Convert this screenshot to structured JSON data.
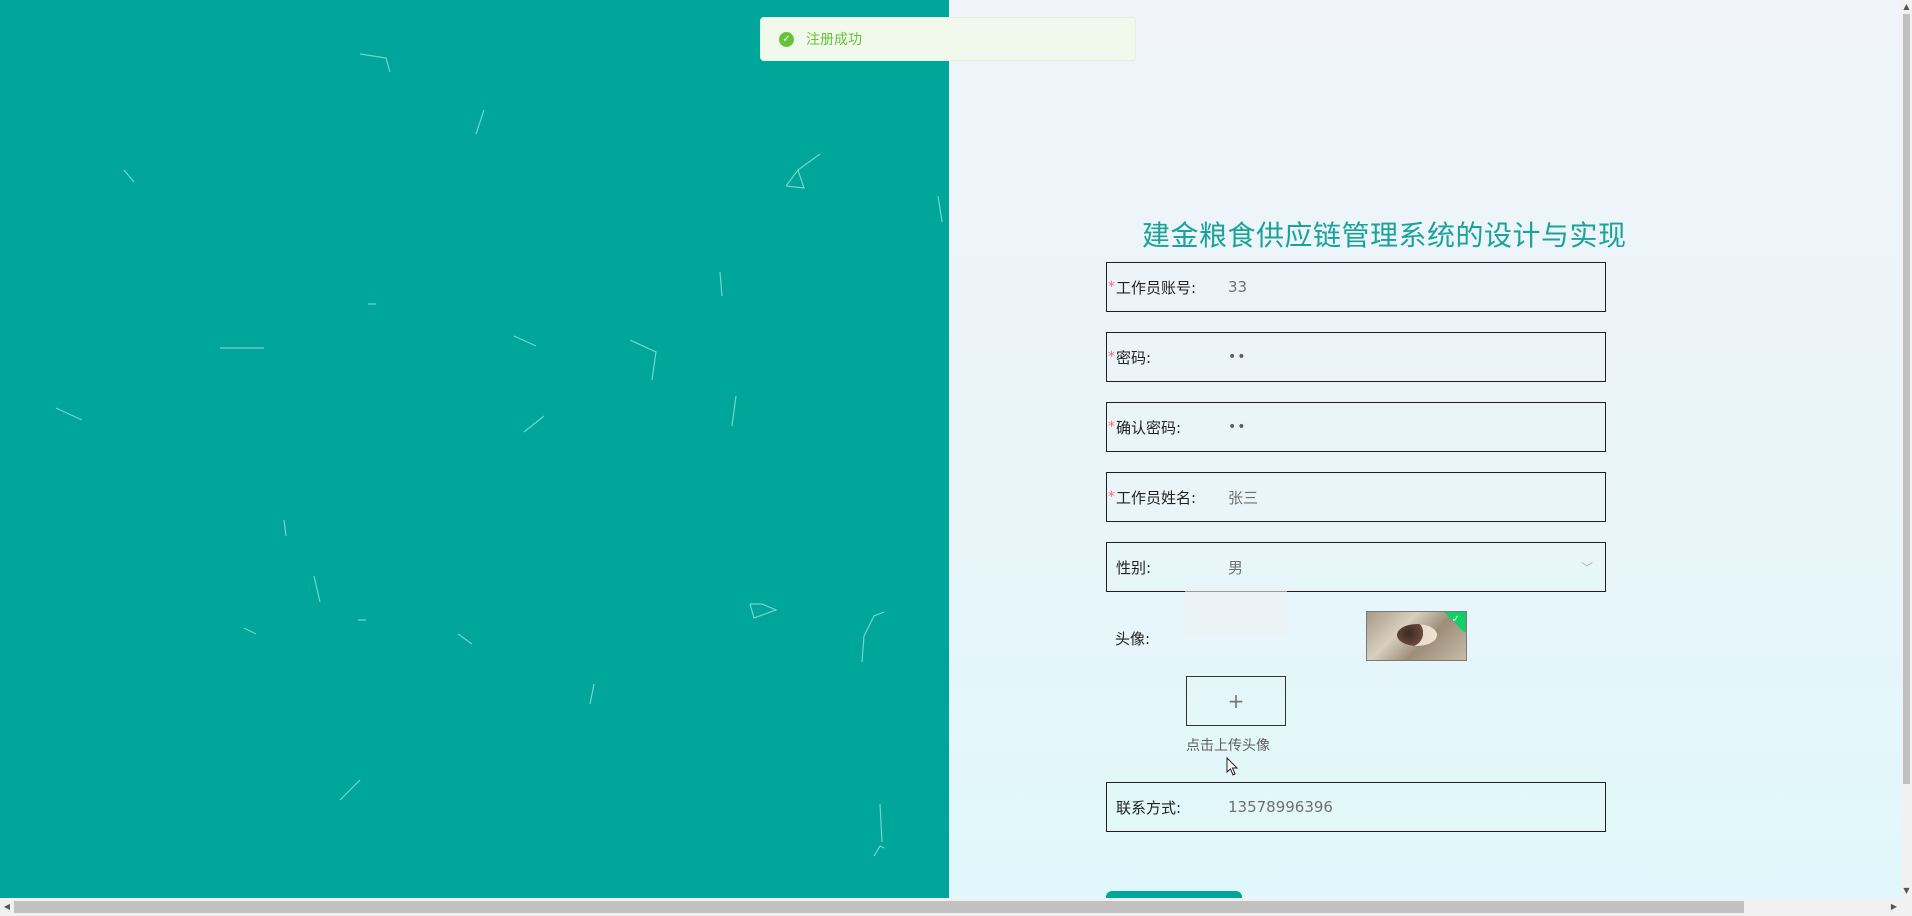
{
  "toast": {
    "message": "注册成功",
    "icon": "check-circle-icon",
    "color": "#67c23a"
  },
  "title": "建金粮食供应链管理系统的设计与实现",
  "form": {
    "account": {
      "label": "工作员账号:",
      "value": "33"
    },
    "password": {
      "label": "密码:",
      "value": "••"
    },
    "confirm_password": {
      "label": "确认密码:",
      "value": "••"
    },
    "name": {
      "label": "工作员姓名:",
      "value": "张三"
    },
    "gender": {
      "label": "性别:",
      "value": "男"
    },
    "avatar": {
      "label": "头像:",
      "upload_symbol": "+",
      "upload_tip": "点击上传头像"
    },
    "phone": {
      "label": "联系方式:",
      "value": "13578996396"
    },
    "required_mark": "*"
  },
  "colors": {
    "primary": "#00a69a",
    "title": "#1aa39a",
    "required": "#f56c6c"
  }
}
